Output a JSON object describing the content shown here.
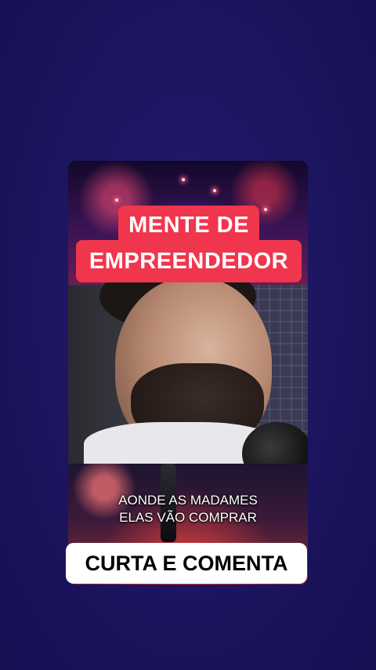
{
  "overlay": {
    "title_line_1": "MENTE DE",
    "title_line_2": "EMPREENDEDOR"
  },
  "captions": {
    "line_1": "AONDE AS MADAMES",
    "line_2": "ELAS VÃO COMPRAR"
  },
  "cta": {
    "label": "CURTA E COMENTA"
  },
  "colors": {
    "background": "#1d1662",
    "title_box": "#f0364d",
    "cta_box": "#ffffff"
  }
}
